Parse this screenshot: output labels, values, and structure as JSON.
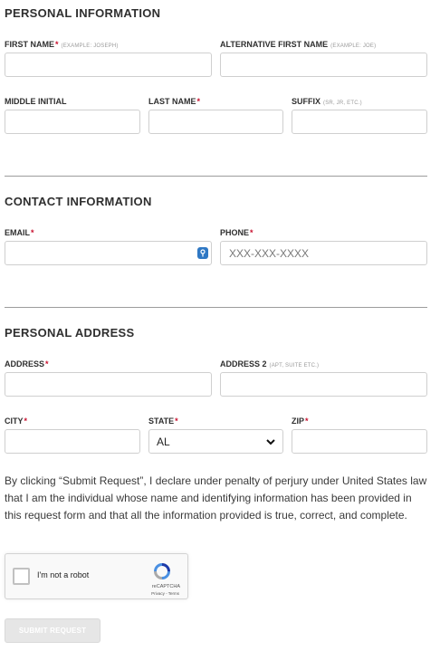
{
  "sections": {
    "personal_info_title": "PERSONAL INFORMATION",
    "contact_info_title": "CONTACT INFORMATION",
    "personal_address_title": "PERSONAL ADDRESS"
  },
  "fields": {
    "first_name": {
      "label": "FIRST NAME",
      "required_mark": "*",
      "hint": "(EXAMPLE: JOSEPH)",
      "value": ""
    },
    "alt_first_name": {
      "label": "ALTERNATIVE FIRST NAME",
      "hint": "(EXAMPLE: JOE)",
      "value": ""
    },
    "middle_initial": {
      "label": "MIDDLE INITIAL",
      "value": ""
    },
    "last_name": {
      "label": "LAST NAME",
      "required_mark": "*",
      "value": ""
    },
    "suffix": {
      "label": "SUFFIX",
      "hint": "(SR, JR, ETC.)",
      "value": ""
    },
    "email": {
      "label": "EMAIL",
      "required_mark": "*",
      "value": ""
    },
    "phone": {
      "label": "PHONE",
      "required_mark": "*",
      "placeholder": "XXX-XXX-XXXX"
    },
    "address": {
      "label": "ADDRESS",
      "required_mark": "*",
      "value": ""
    },
    "address2": {
      "label": "ADDRESS 2",
      "hint": "(APT, SUITE ETC.)",
      "value": ""
    },
    "city": {
      "label": "CITY",
      "required_mark": "*",
      "value": ""
    },
    "state": {
      "label": "STATE",
      "required_mark": "*",
      "selected": "AL"
    },
    "zip": {
      "label": "ZIP",
      "required_mark": "*",
      "value": ""
    }
  },
  "disclaimer": "By clicking “Submit Request”, I declare under penalty of perjury under United States law that I am the individual whose name and identifying information has been provided in this request form and that all the information provided is true, correct, and complete.",
  "recaptcha": {
    "label": "I'm not a robot",
    "brand": "reCAPTCHA",
    "terms": "Privacy - Terms"
  },
  "submit_label": "SUBMIT REQUEST",
  "colors": {
    "required": "#c8102e",
    "autofill_icon": "#2f78c4",
    "submit_bg": "#e6e6e6"
  }
}
